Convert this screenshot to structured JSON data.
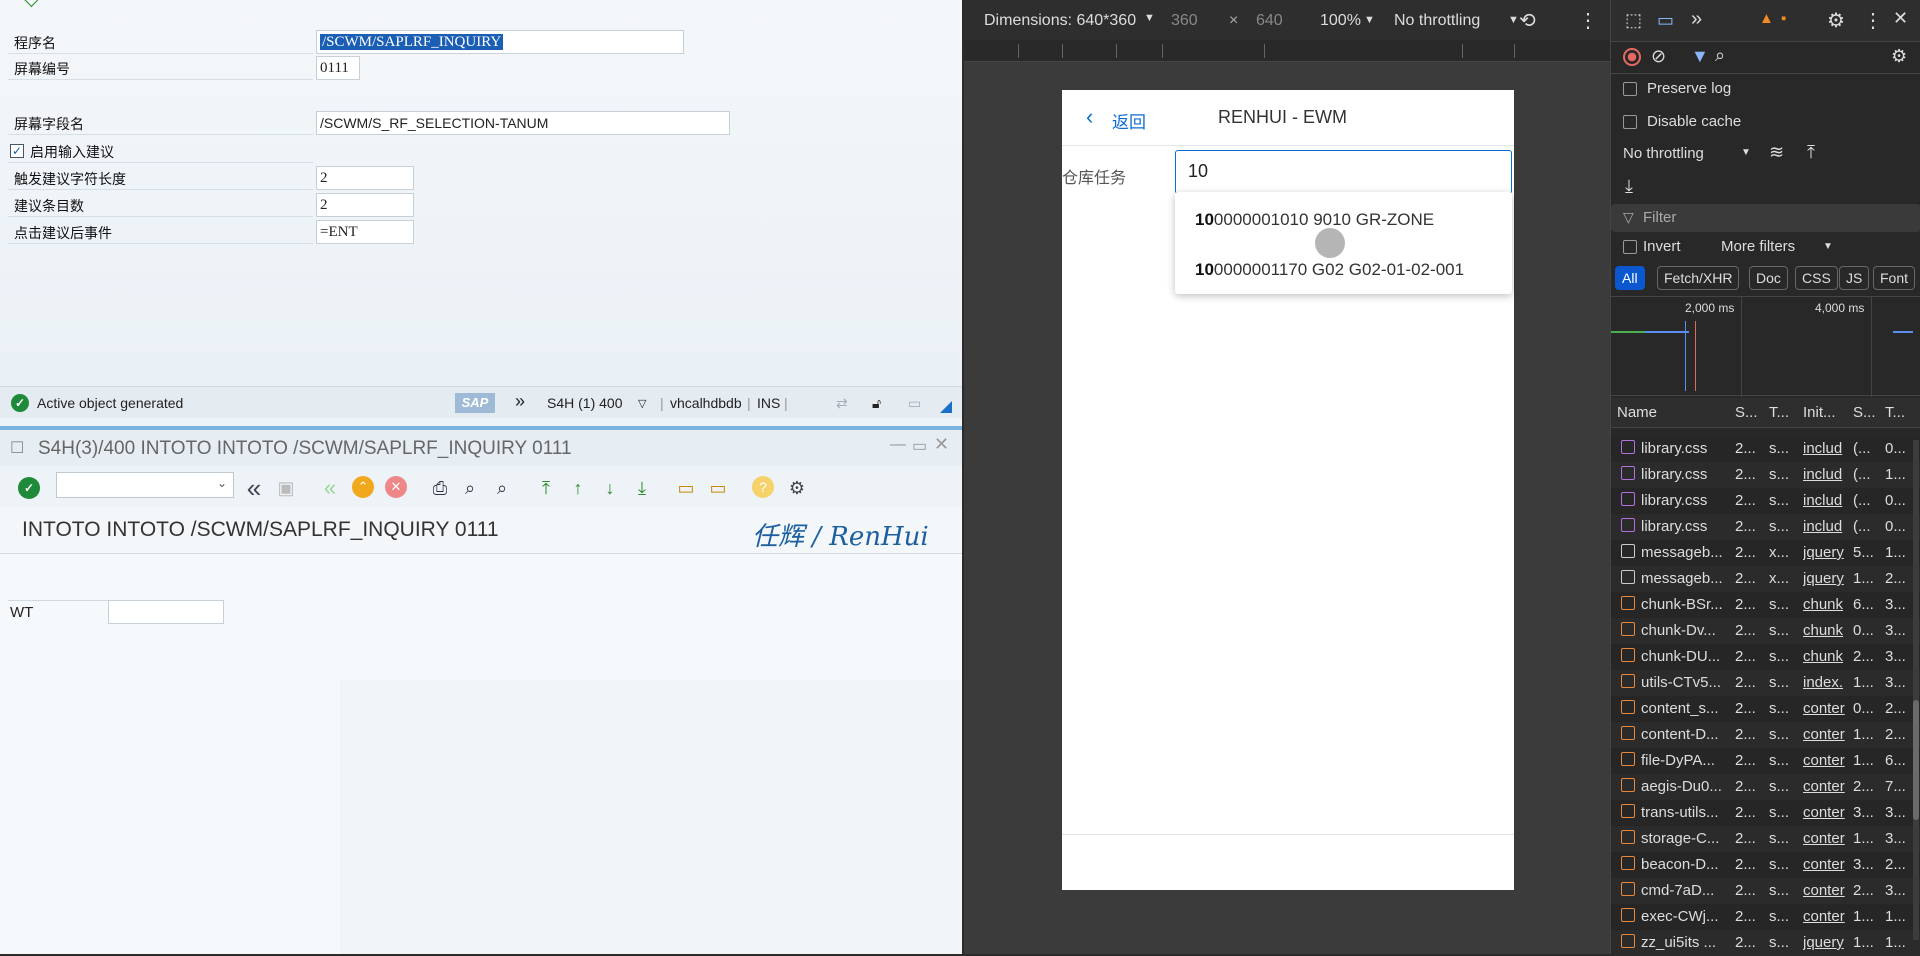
{
  "sap_fields": {
    "program_label": "程序名",
    "program_value": "/SCWM/SAPLRF_INQUIRY",
    "screen_label": "屏幕编号",
    "screen_value": "0111",
    "field_label": "屏幕字段名",
    "field_value": "/SCWM/S_RF_SELECTION-TANUM",
    "enable_label": "启用输入建议",
    "trigger_label": "触发建议字符长度",
    "trigger_value": "2",
    "count_label": "建议条目数",
    "count_value": "2",
    "event_label": "点击建议后事件",
    "event_value": "=ENT"
  },
  "sap_status": {
    "message": "Active object generated",
    "system": "S4H (1) 400",
    "host": "vhcalhdbdb",
    "mode": "INS",
    "sap_logo": "SAP"
  },
  "sap_window2": {
    "title": "S4H(3)/400 INTOTO INTOTO /SCWM/SAPLRF_INQUIRY 0111",
    "header": "INTOTO INTOTO /SCWM/SAPLRF_INQUIRY 0111",
    "brand": "任辉 / RenHui",
    "wt_label": "WT",
    "wt_value": ""
  },
  "devtools_bar": {
    "dimensions": "Dimensions: 640*360",
    "width": "360",
    "x": "×",
    "height": "640",
    "zoom": "100%",
    "throttling": "No throttling"
  },
  "phone": {
    "back_label": "返回",
    "app_title": "RENHUI - EWM",
    "task_label": "仓库任务",
    "task_value": "10",
    "suggestions": [
      {
        "prefix": "10",
        "rest": "0000001010 9010 GR-ZONE"
      },
      {
        "prefix": "10",
        "rest": "0000001170 G02 G02-01-02-001"
      }
    ]
  },
  "network": {
    "preserve_log": "Preserve log",
    "disable_cache": "Disable cache",
    "throttling": "No throttling",
    "filter_placeholder": "Filter",
    "invert": "Invert",
    "more_filters": "More filters",
    "types": [
      "All",
      "Fetch/XHR",
      "Doc",
      "CSS",
      "JS",
      "Font"
    ],
    "timeline_ticks": [
      "2,000 ms",
      "4,000 ms"
    ],
    "columns": [
      "Name",
      "S...",
      "T...",
      "Init...",
      "S...",
      "T..."
    ],
    "rows": [
      {
        "type": "css",
        "name": "library.css",
        "status": "2...",
        "t": "s...",
        "init": "includ",
        "size": "(...",
        "time": "0..."
      },
      {
        "type": "css",
        "name": "library.css",
        "status": "2...",
        "t": "s...",
        "init": "includ",
        "size": "(...",
        "time": "1..."
      },
      {
        "type": "css",
        "name": "library.css",
        "status": "2...",
        "t": "s...",
        "init": "includ",
        "size": "(...",
        "time": "0..."
      },
      {
        "type": "css",
        "name": "library.css",
        "status": "2...",
        "t": "s...",
        "init": "includ",
        "size": "(...",
        "time": "0..."
      },
      {
        "type": "doc",
        "name": "messageb...",
        "status": "2...",
        "t": "x...",
        "init": "jquery",
        "size": "5...",
        "time": "1..."
      },
      {
        "type": "doc",
        "name": "messageb...",
        "status": "2...",
        "t": "x...",
        "init": "jquery",
        "size": "1...",
        "time": "2..."
      },
      {
        "type": "js",
        "name": "chunk-BSr...",
        "status": "2...",
        "t": "s...",
        "init": "chunk",
        "size": "6...",
        "time": "3..."
      },
      {
        "type": "js",
        "name": "chunk-Dv...",
        "status": "2...",
        "t": "s...",
        "init": "chunk",
        "size": "0...",
        "time": "3..."
      },
      {
        "type": "js",
        "name": "chunk-DU...",
        "status": "2...",
        "t": "s...",
        "init": "chunk",
        "size": "2...",
        "time": "3..."
      },
      {
        "type": "js",
        "name": "utils-CTv5...",
        "status": "2...",
        "t": "s...",
        "init": "index.",
        "size": "1...",
        "time": "3..."
      },
      {
        "type": "js",
        "name": "content_s...",
        "status": "2...",
        "t": "s...",
        "init": "conter",
        "size": "0...",
        "time": "2..."
      },
      {
        "type": "js",
        "name": "content-D...",
        "status": "2...",
        "t": "s...",
        "init": "conter",
        "size": "1...",
        "time": "2..."
      },
      {
        "type": "js",
        "name": "file-DyPA...",
        "status": "2...",
        "t": "s...",
        "init": "conter",
        "size": "1...",
        "time": "6..."
      },
      {
        "type": "js",
        "name": "aegis-Du0...",
        "status": "2...",
        "t": "s...",
        "init": "conter",
        "size": "2...",
        "time": "7..."
      },
      {
        "type": "js",
        "name": "trans-utils...",
        "status": "2...",
        "t": "s...",
        "init": "conter",
        "size": "3...",
        "time": "3..."
      },
      {
        "type": "js",
        "name": "storage-C...",
        "status": "2...",
        "t": "s...",
        "init": "conter",
        "size": "1...",
        "time": "3..."
      },
      {
        "type": "js",
        "name": "beacon-D...",
        "status": "2...",
        "t": "s...",
        "init": "conter",
        "size": "3...",
        "time": "2..."
      },
      {
        "type": "js",
        "name": "cmd-7aD...",
        "status": "2...",
        "t": "s...",
        "init": "conter",
        "size": "2...",
        "time": "3..."
      },
      {
        "type": "js",
        "name": "exec-CWj...",
        "status": "2...",
        "t": "s...",
        "init": "conter",
        "size": "1...",
        "time": "1..."
      },
      {
        "type": "js",
        "name": "zz_ui5its ...",
        "status": "2...",
        "t": "s...",
        "init": "jquery",
        "size": "1...",
        "time": "1..."
      }
    ]
  }
}
